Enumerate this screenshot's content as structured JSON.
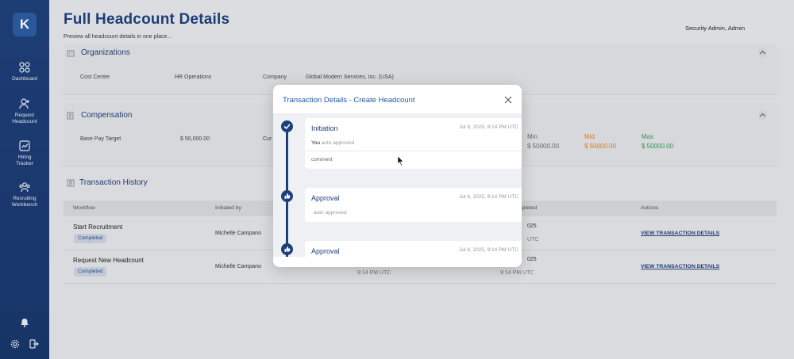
{
  "app": {
    "logo_letter": "K"
  },
  "sidebar": {
    "items": [
      {
        "label1": "Dashboard",
        "label2": ""
      },
      {
        "label1": "Request",
        "label2": "Headcount"
      },
      {
        "label1": "Hiring",
        "label2": "Tracker"
      },
      {
        "label1": "Recruiting",
        "label2": "Workbench"
      }
    ]
  },
  "header": {
    "title": "Full Headcount Details",
    "subtitle": "Preview all headcount details in one place...",
    "user": "Security Admin, Admin"
  },
  "organizations": {
    "title": "Organizations",
    "cost_center_label": "Cost Center",
    "cost_center_value": "HR Operations",
    "company_label": "Company",
    "company_value": "Global Modern Services, Inc. (USA)"
  },
  "compensation": {
    "title": "Compensation",
    "base_pay_label": "Base Pay Target",
    "base_pay_value": "$ 50,000.00",
    "currency_label_partial": "Cur",
    "min_label": "Min",
    "min_value": "$ 50000.00",
    "mid_label": "Mid",
    "mid_value": "$ 50000.00",
    "max_label": "Max",
    "max_value": "$ 50000.00",
    "colors": {
      "min": "#6b6b6b",
      "mid": "#d9822b",
      "max": "#2e9e5a"
    }
  },
  "history": {
    "title": "Transaction History",
    "columns": {
      "workflow": "Workflow",
      "initiated_by": "Initiated by",
      "completed": "mpleted",
      "actions": "Actions"
    },
    "rows": [
      {
        "workflow": "Start Recruitment",
        "status": "Completed",
        "initiated_by": "Michelle Campano",
        "completed_partial": "025",
        "completed_time": "UTC",
        "action": "VIEW TRANSACTION DETAILS"
      },
      {
        "workflow": "Request New Headcount",
        "status": "Completed",
        "initiated_by": "Michelle Campano",
        "initiated_time": "9:14 PM UTC",
        "completed_partial": "025",
        "completed_time": "9:14 PM UTC",
        "action": "VIEW TRANSACTION DETAILS"
      }
    ]
  },
  "modal": {
    "title": "Transaction Details - Create Headcount",
    "steps": [
      {
        "title": "Initiation",
        "time": "Jul 8, 2025, 9:14 PM UTC",
        "actor": "You",
        "note": "auto approved",
        "comment": "comment"
      },
      {
        "title": "Approval",
        "time": "Jul 8, 2025, 9:14 PM UTC",
        "note": "auto approved"
      },
      {
        "title": "Approval",
        "time": "Jul 8, 2025, 9:14 PM UTC"
      }
    ]
  }
}
